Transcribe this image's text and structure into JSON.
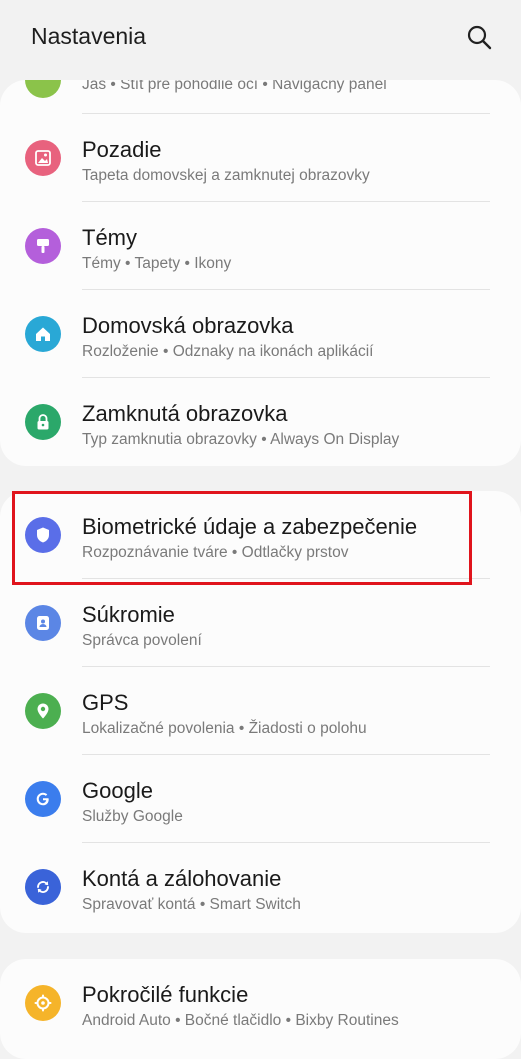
{
  "header": {
    "title": "Nastavenia",
    "search_icon": "search-icon"
  },
  "card1": {
    "partial": {
      "sub": "Jas  •  Štít pre pohodlie očí  •  Navigačný panel",
      "color": "#8bc34a"
    },
    "items": [
      {
        "label": "Pozadie",
        "sub": "Tapeta domovskej a zamknutej obrazovky",
        "icon": "wallpaper-icon",
        "color": "#e8627e"
      },
      {
        "label": "Témy",
        "sub": "Témy  •  Tapety  •  Ikony",
        "icon": "themes-icon",
        "color": "#b45fdb"
      },
      {
        "label": "Domovská obrazovka",
        "sub": "Rozloženie  •  Odznaky na ikonách aplikácií",
        "icon": "home-icon",
        "color": "#29a8d6"
      },
      {
        "label": "Zamknutá obrazovka",
        "sub": "Typ zamknutia obrazovky  •  Always On Display",
        "icon": "lock-icon",
        "color": "#2ba86a"
      }
    ]
  },
  "card2": {
    "items": [
      {
        "label": "Biometrické údaje a zabezpečenie",
        "sub": "Rozpoznávanie tváre  •  Odtlačky prstov",
        "icon": "shield-icon",
        "color": "#5a6ee8"
      },
      {
        "label": "Súkromie",
        "sub": "Správca povolení",
        "icon": "privacy-icon",
        "color": "#5b86e5"
      },
      {
        "label": "GPS",
        "sub": "Lokalizačné povolenia  •  Žiadosti o polohu",
        "icon": "location-pin-icon",
        "color": "#4caf50"
      },
      {
        "label": "Google",
        "sub": "Služby Google",
        "icon": "google-icon",
        "color": "#3b7ded"
      },
      {
        "label": "Kontá a zálohovanie",
        "sub": "Spravovať kontá  •  Smart Switch",
        "icon": "sync-icon",
        "color": "#3a63d9"
      }
    ]
  },
  "card3": {
    "items": [
      {
        "label": "Pokročilé funkcie",
        "sub": "Android Auto  •  Bočné tlačidlo  •  Bixby Routines",
        "icon": "advanced-features-icon",
        "color": "#f5b42a"
      }
    ]
  },
  "highlight_color": "#e0141c"
}
